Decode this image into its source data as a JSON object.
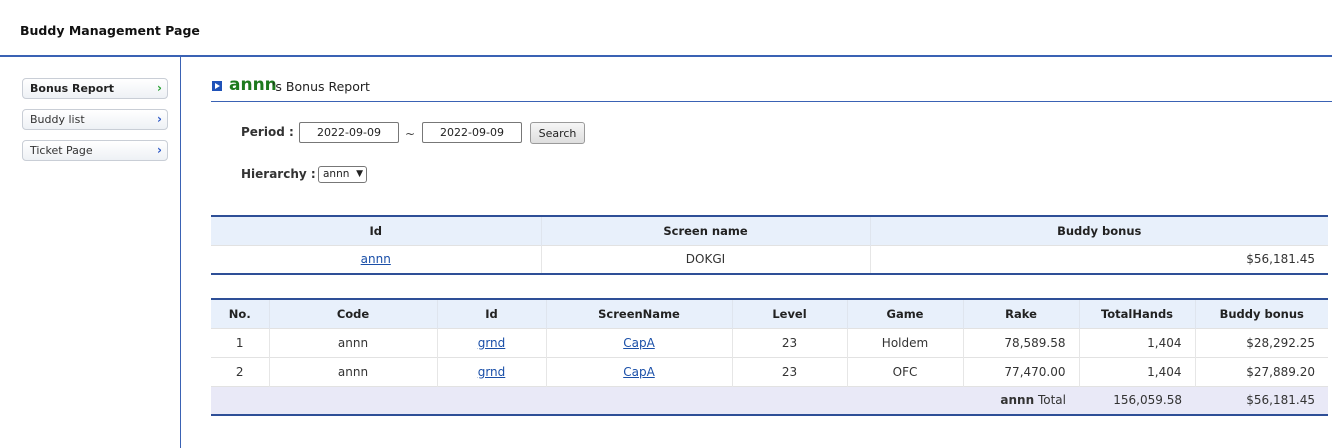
{
  "header": {
    "title": "Buddy Management Page"
  },
  "sidebar": {
    "items": [
      {
        "label": "Bonus Report",
        "chevron": "›"
      },
      {
        "label": "Buddy list",
        "chevron": "›"
      },
      {
        "label": "Ticket Page",
        "chevron": "›"
      }
    ]
  },
  "report": {
    "user": "annn",
    "title_suffix": "'s Bonus Report"
  },
  "filters": {
    "period_label": "Period :",
    "date_from": "2022-09-09",
    "separator": "~",
    "date_to": "2022-09-09",
    "search_label": "Search",
    "hierarchy_label": "Hierarchy :",
    "hierarchy_value": "annn"
  },
  "summary": {
    "headers": [
      "Id",
      "Screen name",
      "Buddy bonus"
    ],
    "row": {
      "id": "annn",
      "screen_name": "DOKGI",
      "buddy_bonus": "$56,181.45"
    }
  },
  "detail": {
    "headers": [
      "No.",
      "Code",
      "Id",
      "ScreenName",
      "Level",
      "Game",
      "Rake",
      "TotalHands",
      "Buddy bonus"
    ],
    "rows": [
      {
        "no": "1",
        "code": "annn",
        "id": "grnd",
        "screen_name": "CapA",
        "level": "23",
        "game": "Holdem",
        "rake": "78,589.58",
        "hands": "1,404",
        "bonus": "$28,292.25"
      },
      {
        "no": "2",
        "code": "annn",
        "id": "grnd",
        "screen_name": "CapA",
        "level": "23",
        "game": "OFC",
        "rake": "77,470.00",
        "hands": "1,404",
        "bonus": "$27,889.20"
      }
    ],
    "total": {
      "user": "annn",
      "label": "Total",
      "rake": "156,059.58",
      "bonus": "$56,181.45"
    }
  },
  "colors": {
    "accent": "#3a62b4",
    "user_green": "#1e7a1e",
    "link": "#1a4fa8",
    "header_bg": "#e8f0fb"
  }
}
